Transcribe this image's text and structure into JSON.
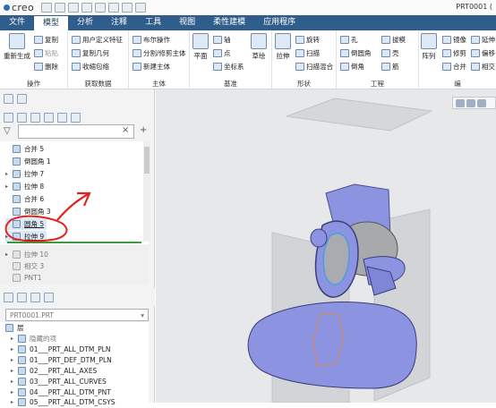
{
  "app": {
    "logo": "creo",
    "window_title": "PRT0001 ("
  },
  "tabs": [
    "文件",
    "模型",
    "分析",
    "注释",
    "工具",
    "视图",
    "柔性建模",
    "应用程序"
  ],
  "ribbon": {
    "reg": "重新生成",
    "op": [
      "复制",
      "粘贴",
      "删除"
    ],
    "op_lbl": "操作",
    "get": [
      "用户定义特征",
      "复制几何",
      "收缩包络"
    ],
    "get_lbl": "获取数据",
    "body": [
      "布尔操作",
      "分割/修剪主体",
      "新建主体"
    ],
    "body_lbl": "主体",
    "ref": [
      "平面",
      "轴",
      "点",
      "坐标系",
      "草绘"
    ],
    "ref_lbl": "基准",
    "shape": [
      "拉伸",
      "旋转",
      "扫描",
      "扫描混合"
    ],
    "shape_lbl": "形状",
    "eng": [
      "孔",
      "倒圆角",
      "倒角",
      "拔模",
      "壳",
      "筋"
    ],
    "eng_lbl": "工程",
    "edit": [
      "阵列",
      "镜像",
      "修剪",
      "合并",
      "延伸",
      "偏移",
      "相交"
    ],
    "edit_lbl": "编"
  },
  "model_tree": {
    "items": [
      {
        "label": "合并 5",
        "state": "normal"
      },
      {
        "label": "倒圆角 1",
        "state": "normal"
      },
      {
        "label": "拉伸 7",
        "state": "normal"
      },
      {
        "label": "拉伸 8",
        "state": "normal"
      },
      {
        "label": "合并 6",
        "state": "normal"
      },
      {
        "label": "倒圆角 3",
        "state": "normal"
      },
      {
        "label": "圆角 5",
        "state": "highlight"
      },
      {
        "label": "拉伸 9",
        "state": "highlight"
      }
    ],
    "suppressed": [
      {
        "label": "拉伸 10"
      },
      {
        "label": "相交 3"
      },
      {
        "label": "PNT1"
      }
    ]
  },
  "layers": {
    "part": "PRT0001.PRT",
    "title": "层",
    "items": [
      "隐藏的项",
      "01___PRT_ALL_DTM_PLN",
      "01___PRT_DEF_DTM_PLN",
      "02___PRT_ALL_AXES",
      "03___PRT_ALL_CURVES",
      "04___PRT_ALL_DTM_PNT",
      "05___PRT_ALL_DTM_CSYS"
    ]
  }
}
